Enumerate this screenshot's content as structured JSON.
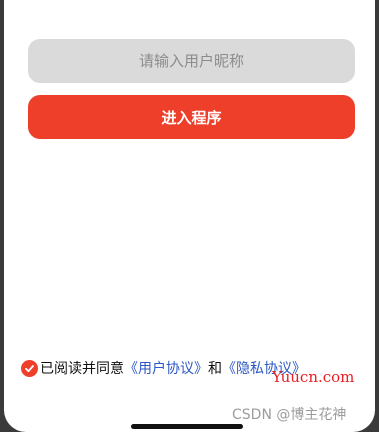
{
  "form": {
    "nickname_placeholder": "请输入用户昵称",
    "nickname_value": "",
    "enter_label": "进入程序"
  },
  "agreement": {
    "checked": true,
    "prefix": "已阅读并同意",
    "user_agreement": "《用户协议》",
    "conjunction": "和",
    "privacy_policy": "《隐私协议》"
  },
  "watermarks": {
    "site": "Yuucn.com",
    "author": "CSDN @博主花神"
  },
  "colors": {
    "accent": "#ee3f2a",
    "link": "#2b59c3",
    "input_bg": "#dadada"
  }
}
